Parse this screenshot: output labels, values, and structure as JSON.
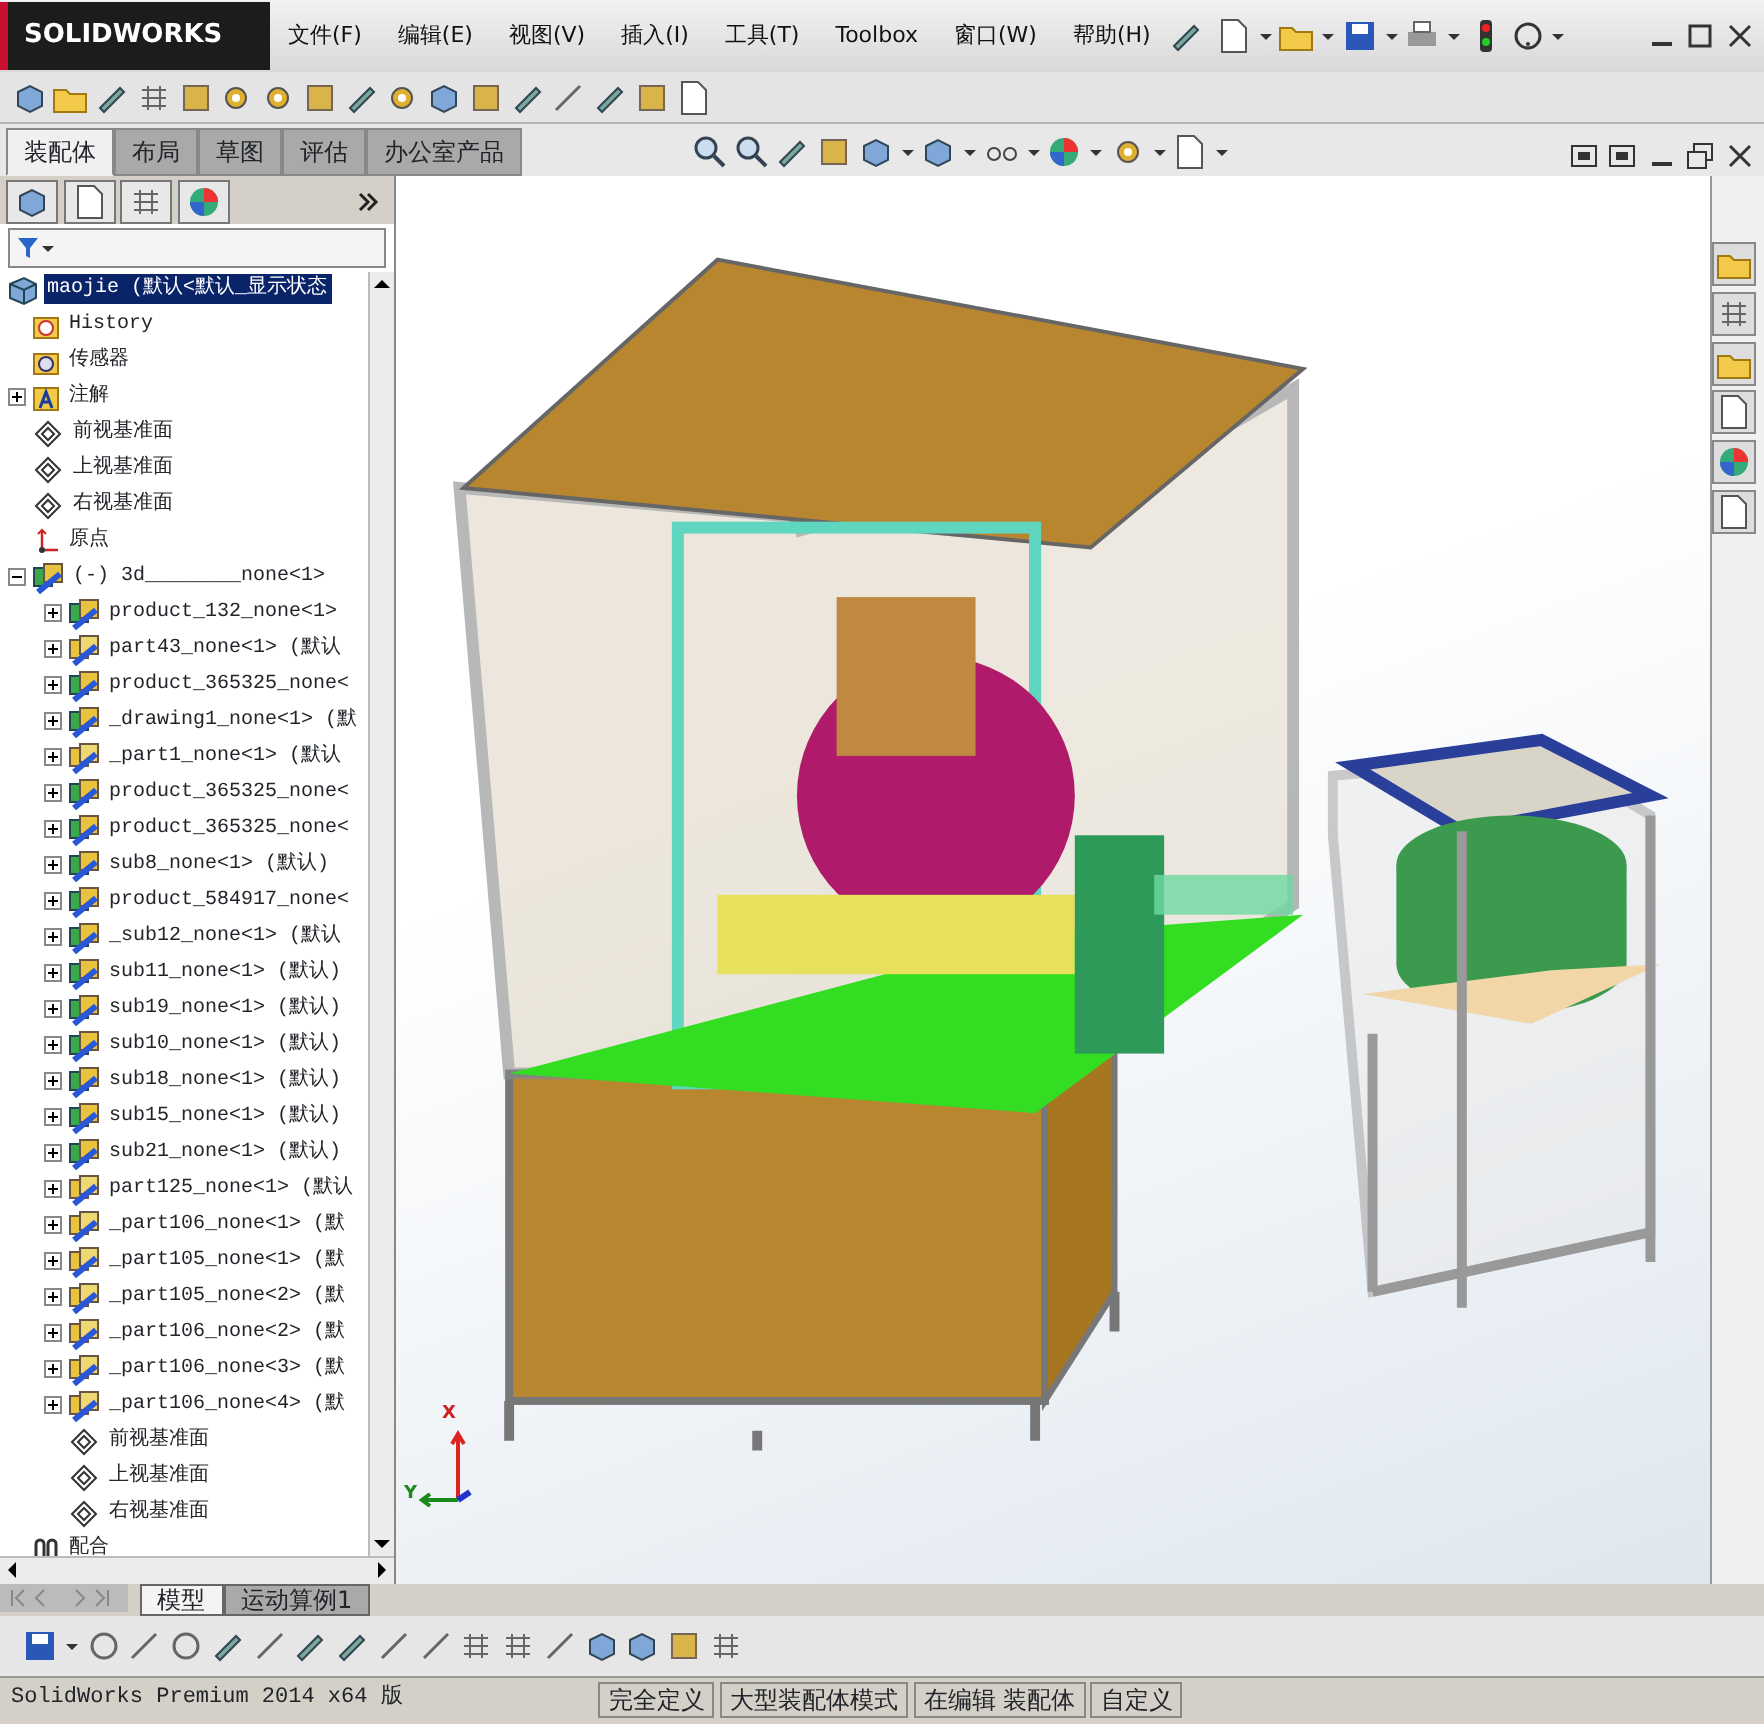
{
  "title_bar": {
    "logo": "SOLIDWORKS",
    "menus": [
      "文件(F)",
      "编辑(E)",
      "视图(V)",
      "插入(I)",
      "工具(T)",
      "Toolbox",
      "窗口(W)",
      "帮助(H)"
    ]
  },
  "command_tabs": [
    {
      "label": "装配体",
      "selected": true
    },
    {
      "label": "布局",
      "selected": false
    },
    {
      "label": "草图",
      "selected": false
    },
    {
      "label": "评估",
      "selected": false
    },
    {
      "label": "办公室产品",
      "selected": false
    }
  ],
  "feature_tree": {
    "root": {
      "label": "maojie  (默认<默认_显示状态",
      "selected": true
    },
    "items": [
      {
        "kind": "history",
        "label": "History"
      },
      {
        "kind": "sensor",
        "label": "传感器"
      },
      {
        "kind": "annotation",
        "label": "注解",
        "expanded": false
      },
      {
        "kind": "plane",
        "label": "前视基准面"
      },
      {
        "kind": "plane",
        "label": "上视基准面"
      },
      {
        "kind": "plane",
        "label": "右视基准面"
      },
      {
        "kind": "origin",
        "label": "原点"
      },
      {
        "kind": "assembly",
        "label": "(-) 3d________none<1>",
        "expanded": true,
        "children": [
          {
            "kind": "assembly",
            "label": "product_132_none<1>",
            "expanded": false
          },
          {
            "kind": "part",
            "label": "part43_none<1> (默认",
            "expanded": false
          },
          {
            "kind": "assembly",
            "label": "product_365325_none<",
            "expanded": false
          },
          {
            "kind": "assembly",
            "label": "_drawing1_none<1> (默",
            "expanded": false
          },
          {
            "kind": "part",
            "label": "_part1_none<1> (默认",
            "expanded": false
          },
          {
            "kind": "assembly",
            "label": "product_365325_none<",
            "expanded": false
          },
          {
            "kind": "assembly",
            "label": "product_365325_none<",
            "expanded": false
          },
          {
            "kind": "assembly",
            "label": "sub8_none<1> (默认)",
            "expanded": false
          },
          {
            "kind": "assembly",
            "label": "product_584917_none<",
            "expanded": false
          },
          {
            "kind": "assembly",
            "label": "_sub12_none<1> (默认",
            "expanded": false
          },
          {
            "kind": "assembly",
            "label": "sub11_none<1> (默认)",
            "expanded": false
          },
          {
            "kind": "assembly",
            "label": "sub19_none<1> (默认)",
            "expanded": false
          },
          {
            "kind": "assembly",
            "label": "sub10_none<1> (默认)",
            "expanded": false
          },
          {
            "kind": "assembly",
            "label": "sub18_none<1> (默认)",
            "expanded": false
          },
          {
            "kind": "assembly",
            "label": "sub15_none<1> (默认)",
            "expanded": false
          },
          {
            "kind": "assembly",
            "label": "sub21_none<1> (默认)",
            "expanded": false
          },
          {
            "kind": "part",
            "label": "part125_none<1> (默认",
            "expanded": false
          },
          {
            "kind": "part",
            "label": "_part106_none<1> (默",
            "expanded": false
          },
          {
            "kind": "part",
            "label": "_part105_none<1> (默",
            "expanded": false
          },
          {
            "kind": "part",
            "label": "_part105_none<2> (默",
            "expanded": false
          },
          {
            "kind": "part",
            "label": "_part106_none<2> (默",
            "expanded": false
          },
          {
            "kind": "part",
            "label": "_part106_none<3> (默",
            "expanded": false
          },
          {
            "kind": "part",
            "label": "_part106_none<4> (默",
            "expanded": false
          },
          {
            "kind": "plane",
            "label": "前视基准面"
          },
          {
            "kind": "plane",
            "label": "上视基准面"
          },
          {
            "kind": "plane",
            "label": "右视基准面"
          }
        ]
      },
      {
        "kind": "mates",
        "label": "配合"
      }
    ]
  },
  "bottom_tabs": [
    {
      "label": "模型",
      "selected": true
    },
    {
      "label": "运动算例1",
      "selected": false
    }
  ],
  "triad": {
    "x_label": "X",
    "y_label": "Y"
  },
  "status_bar": {
    "product": "SolidWorks Premium 2014 x64 版",
    "segments": [
      "完全定义",
      "大型装配体模式",
      "在编辑 装配体",
      "自定义"
    ]
  }
}
